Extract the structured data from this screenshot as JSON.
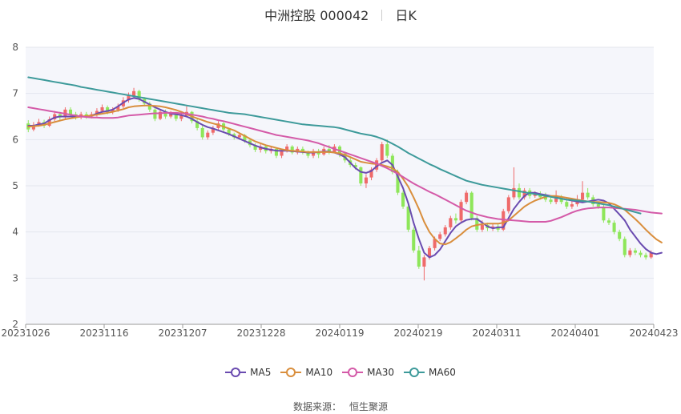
{
  "header": {
    "stock_title": "中洲控股 000042",
    "period_label": "日K"
  },
  "source": {
    "label": "数据来源：",
    "value": "恒生聚源"
  },
  "colors": {
    "up": "#ef6a6a",
    "down": "#8ee65a",
    "MA5": "#6a4bb0",
    "MA10": "#d98e3c",
    "MA30": "#d45aa8",
    "MA60": "#3d9a9a",
    "plot_bg": "#f5f6fb",
    "grid": "#e4e6ee"
  },
  "chart_data": {
    "type": "candlestick",
    "title": "中洲控股 000042",
    "subtitle": "日K",
    "ylim": [
      2,
      8
    ],
    "yticks": [
      2,
      3,
      4,
      5,
      6,
      7,
      8
    ],
    "grid": true,
    "legend_position": "bottom",
    "xticks": [
      "20231026",
      "20231116",
      "20231207",
      "20231228",
      "20240119",
      "20240219",
      "20240311",
      "20240401",
      "20240423"
    ],
    "candles": [
      {
        "o": 6.35,
        "c": 6.22,
        "h": 6.42,
        "l": 6.16
      },
      {
        "o": 6.22,
        "c": 6.32,
        "h": 6.38,
        "l": 6.18
      },
      {
        "o": 6.32,
        "c": 6.38,
        "h": 6.45,
        "l": 6.28
      },
      {
        "o": 6.38,
        "c": 6.3,
        "h": 6.43,
        "l": 6.25
      },
      {
        "o": 6.3,
        "c": 6.44,
        "h": 6.5,
        "l": 6.27
      },
      {
        "o": 6.44,
        "c": 6.55,
        "h": 6.62,
        "l": 6.4
      },
      {
        "o": 6.55,
        "c": 6.48,
        "h": 6.6,
        "l": 6.42
      },
      {
        "o": 6.48,
        "c": 6.65,
        "h": 6.7,
        "l": 6.45
      },
      {
        "o": 6.65,
        "c": 6.55,
        "h": 6.7,
        "l": 6.5
      },
      {
        "o": 6.55,
        "c": 6.48,
        "h": 6.6,
        "l": 6.43
      },
      {
        "o": 6.48,
        "c": 6.55,
        "h": 6.6,
        "l": 6.44
      },
      {
        "o": 6.55,
        "c": 6.5,
        "h": 6.6,
        "l": 6.45
      },
      {
        "o": 6.5,
        "c": 6.55,
        "h": 6.6,
        "l": 6.46
      },
      {
        "o": 6.55,
        "c": 6.62,
        "h": 6.68,
        "l": 6.5
      },
      {
        "o": 6.62,
        "c": 6.7,
        "h": 6.76,
        "l": 6.58
      },
      {
        "o": 6.7,
        "c": 6.6,
        "h": 6.74,
        "l": 6.55
      },
      {
        "o": 6.6,
        "c": 6.65,
        "h": 6.7,
        "l": 6.55
      },
      {
        "o": 6.65,
        "c": 6.72,
        "h": 6.78,
        "l": 6.6
      },
      {
        "o": 6.72,
        "c": 6.85,
        "h": 6.92,
        "l": 6.68
      },
      {
        "o": 6.85,
        "c": 6.95,
        "h": 7.02,
        "l": 6.8
      },
      {
        "o": 6.95,
        "c": 7.05,
        "h": 7.12,
        "l": 6.9
      },
      {
        "o": 7.05,
        "c": 6.88,
        "h": 7.08,
        "l": 6.82
      },
      {
        "o": 6.88,
        "c": 6.78,
        "h": 6.92,
        "l": 6.72
      },
      {
        "o": 6.78,
        "c": 6.65,
        "h": 6.82,
        "l": 6.6
      },
      {
        "o": 6.65,
        "c": 6.45,
        "h": 6.68,
        "l": 6.4
      },
      {
        "o": 6.45,
        "c": 6.6,
        "h": 6.65,
        "l": 6.42
      },
      {
        "o": 6.6,
        "c": 6.5,
        "h": 6.65,
        "l": 6.45
      },
      {
        "o": 6.5,
        "c": 6.55,
        "h": 6.62,
        "l": 6.46
      },
      {
        "o": 6.55,
        "c": 6.45,
        "h": 6.58,
        "l": 6.4
      },
      {
        "o": 6.45,
        "c": 6.52,
        "h": 6.58,
        "l": 6.4
      },
      {
        "o": 6.52,
        "c": 6.6,
        "h": 6.72,
        "l": 6.48
      },
      {
        "o": 6.6,
        "c": 6.4,
        "h": 6.62,
        "l": 6.35
      },
      {
        "o": 6.4,
        "c": 6.25,
        "h": 6.45,
        "l": 6.2
      },
      {
        "o": 6.25,
        "c": 6.05,
        "h": 6.3,
        "l": 6.0
      },
      {
        "o": 6.05,
        "c": 6.15,
        "h": 6.2,
        "l": 6.0
      },
      {
        "o": 6.15,
        "c": 6.25,
        "h": 6.3,
        "l": 6.1
      },
      {
        "o": 6.25,
        "c": 6.35,
        "h": 6.4,
        "l": 6.2
      },
      {
        "o": 6.35,
        "c": 6.22,
        "h": 6.38,
        "l": 6.18
      },
      {
        "o": 6.22,
        "c": 6.12,
        "h": 6.25,
        "l": 6.08
      },
      {
        "o": 6.12,
        "c": 6.05,
        "h": 6.15,
        "l": 6.0
      },
      {
        "o": 6.05,
        "c": 6.1,
        "h": 6.15,
        "l": 6.0
      },
      {
        "o": 6.1,
        "c": 5.98,
        "h": 6.12,
        "l": 5.93
      },
      {
        "o": 5.98,
        "c": 5.88,
        "h": 6.02,
        "l": 5.83
      },
      {
        "o": 5.88,
        "c": 5.78,
        "h": 5.92,
        "l": 5.73
      },
      {
        "o": 5.78,
        "c": 5.85,
        "h": 5.9,
        "l": 5.72
      },
      {
        "o": 5.85,
        "c": 5.75,
        "h": 5.88,
        "l": 5.7
      },
      {
        "o": 5.75,
        "c": 5.8,
        "h": 5.85,
        "l": 5.7
      },
      {
        "o": 5.8,
        "c": 5.65,
        "h": 5.82,
        "l": 5.6
      },
      {
        "o": 5.65,
        "c": 5.75,
        "h": 5.8,
        "l": 5.6
      },
      {
        "o": 5.75,
        "c": 5.85,
        "h": 5.9,
        "l": 5.72
      },
      {
        "o": 5.85,
        "c": 5.72,
        "h": 5.88,
        "l": 5.68
      },
      {
        "o": 5.72,
        "c": 5.8,
        "h": 5.85,
        "l": 5.68
      },
      {
        "o": 5.8,
        "c": 5.72,
        "h": 5.85,
        "l": 5.68
      },
      {
        "o": 5.72,
        "c": 5.65,
        "h": 5.76,
        "l": 5.6
      },
      {
        "o": 5.65,
        "c": 5.75,
        "h": 5.8,
        "l": 5.6
      },
      {
        "o": 5.75,
        "c": 5.68,
        "h": 5.8,
        "l": 5.6
      },
      {
        "o": 5.68,
        "c": 5.8,
        "h": 5.85,
        "l": 5.65
      },
      {
        "o": 5.8,
        "c": 5.72,
        "h": 5.88,
        "l": 5.68
      },
      {
        "o": 5.72,
        "c": 5.85,
        "h": 5.9,
        "l": 5.7
      },
      {
        "o": 5.85,
        "c": 5.7,
        "h": 5.88,
        "l": 5.62
      },
      {
        "o": 5.7,
        "c": 5.55,
        "h": 5.72,
        "l": 5.5
      },
      {
        "o": 5.55,
        "c": 5.45,
        "h": 5.6,
        "l": 5.4
      },
      {
        "o": 5.45,
        "c": 5.4,
        "h": 5.5,
        "l": 5.35
      },
      {
        "o": 5.4,
        "c": 5.05,
        "h": 5.42,
        "l": 5.0
      },
      {
        "o": 5.05,
        "c": 5.18,
        "h": 5.25,
        "l": 4.95
      },
      {
        "o": 5.18,
        "c": 5.35,
        "h": 5.4,
        "l": 5.12
      },
      {
        "o": 5.35,
        "c": 5.55,
        "h": 5.6,
        "l": 5.3
      },
      {
        "o": 5.55,
        "c": 5.9,
        "h": 5.95,
        "l": 5.5
      },
      {
        "o": 5.9,
        "c": 5.65,
        "h": 6.0,
        "l": 5.6
      },
      {
        "o": 5.65,
        "c": 5.3,
        "h": 5.7,
        "l": 5.25
      },
      {
        "o": 5.3,
        "c": 4.85,
        "h": 5.35,
        "l": 4.8
      },
      {
        "o": 4.85,
        "c": 4.55,
        "h": 4.9,
        "l": 4.5
      },
      {
        "o": 4.55,
        "c": 4.05,
        "h": 4.6,
        "l": 4.0
      },
      {
        "o": 4.05,
        "c": 3.6,
        "h": 4.1,
        "l": 3.55
      },
      {
        "o": 3.6,
        "c": 3.25,
        "h": 3.7,
        "l": 3.2
      },
      {
        "o": 3.25,
        "c": 3.45,
        "h": 3.5,
        "l": 2.95
      },
      {
        "o": 3.45,
        "c": 3.65,
        "h": 3.7,
        "l": 3.4
      },
      {
        "o": 3.65,
        "c": 3.85,
        "h": 3.9,
        "l": 3.6
      },
      {
        "o": 3.85,
        "c": 3.95,
        "h": 4.0,
        "l": 3.8
      },
      {
        "o": 3.95,
        "c": 4.1,
        "h": 4.15,
        "l": 3.9
      },
      {
        "o": 4.1,
        "c": 4.3,
        "h": 4.35,
        "l": 4.05
      },
      {
        "o": 4.3,
        "c": 4.25,
        "h": 4.4,
        "l": 4.18
      },
      {
        "o": 4.25,
        "c": 4.65,
        "h": 4.7,
        "l": 4.2
      },
      {
        "o": 4.65,
        "c": 4.85,
        "h": 4.9,
        "l": 4.6
      },
      {
        "o": 4.85,
        "c": 4.3,
        "h": 4.88,
        "l": 4.25
      },
      {
        "o": 4.3,
        "c": 4.05,
        "h": 4.35,
        "l": 4.0
      },
      {
        "o": 4.05,
        "c": 4.15,
        "h": 4.25,
        "l": 4.0
      },
      {
        "o": 4.15,
        "c": 4.08,
        "h": 4.2,
        "l": 4.02
      },
      {
        "o": 4.08,
        "c": 4.12,
        "h": 4.18,
        "l": 4.02
      },
      {
        "o": 4.12,
        "c": 4.05,
        "h": 4.18,
        "l": 4.0
      },
      {
        "o": 4.05,
        "c": 4.45,
        "h": 4.5,
        "l": 4.02
      },
      {
        "o": 4.45,
        "c": 4.75,
        "h": 4.8,
        "l": 4.4
      },
      {
        "o": 4.75,
        "c": 4.95,
        "h": 5.4,
        "l": 4.7
      },
      {
        "o": 4.95,
        "c": 4.75,
        "h": 5.05,
        "l": 4.7
      },
      {
        "o": 4.75,
        "c": 4.9,
        "h": 4.95,
        "l": 4.7
      },
      {
        "o": 4.9,
        "c": 4.78,
        "h": 4.95,
        "l": 4.72
      },
      {
        "o": 4.78,
        "c": 4.82,
        "h": 4.88,
        "l": 4.74
      },
      {
        "o": 4.82,
        "c": 4.75,
        "h": 4.88,
        "l": 4.7
      },
      {
        "o": 4.75,
        "c": 4.7,
        "h": 4.85,
        "l": 4.65
      },
      {
        "o": 4.7,
        "c": 4.65,
        "h": 4.75,
        "l": 4.6
      },
      {
        "o": 4.65,
        "c": 4.75,
        "h": 4.9,
        "l": 4.6
      },
      {
        "o": 4.75,
        "c": 4.65,
        "h": 4.8,
        "l": 4.6
      },
      {
        "o": 4.65,
        "c": 4.55,
        "h": 4.7,
        "l": 4.5
      },
      {
        "o": 4.55,
        "c": 4.6,
        "h": 4.68,
        "l": 4.5
      },
      {
        "o": 4.6,
        "c": 4.7,
        "h": 4.8,
        "l": 4.55
      },
      {
        "o": 4.7,
        "c": 4.85,
        "h": 5.1,
        "l": 4.65
      },
      {
        "o": 4.85,
        "c": 4.75,
        "h": 4.95,
        "l": 4.7
      },
      {
        "o": 4.75,
        "c": 4.6,
        "h": 4.8,
        "l": 4.55
      },
      {
        "o": 4.6,
        "c": 4.55,
        "h": 4.65,
        "l": 4.5
      },
      {
        "o": 4.55,
        "c": 4.25,
        "h": 4.6,
        "l": 4.2
      },
      {
        "o": 4.25,
        "c": 4.2,
        "h": 4.3,
        "l": 4.15
      },
      {
        "o": 4.2,
        "c": 4.0,
        "h": 4.25,
        "l": 3.95
      },
      {
        "o": 4.0,
        "c": 3.85,
        "h": 4.05,
        "l": 3.8
      },
      {
        "o": 3.85,
        "c": 3.5,
        "h": 3.9,
        "l": 3.45
      },
      {
        "o": 3.5,
        "c": 3.6,
        "h": 3.65,
        "l": 3.45
      },
      {
        "o": 3.6,
        "c": 3.55,
        "h": 3.65,
        "l": 3.5
      },
      {
        "o": 3.55,
        "c": 3.5,
        "h": 3.6,
        "l": 3.45
      },
      {
        "o": 3.5,
        "c": 3.45,
        "h": 3.55,
        "l": 3.4
      },
      {
        "o": 3.45,
        "c": 3.55,
        "h": 3.6,
        "l": 3.42
      }
    ],
    "series": [
      {
        "name": "MA5",
        "values": [
          6.3,
          6.3,
          6.33,
          6.35,
          6.42,
          6.48,
          6.5,
          6.5,
          6.5,
          6.5,
          6.5,
          6.5,
          6.52,
          6.56,
          6.6,
          6.62,
          6.65,
          6.72,
          6.8,
          6.87,
          6.9,
          6.88,
          6.82,
          6.76,
          6.7,
          6.65,
          6.6,
          6.56,
          6.55,
          6.53,
          6.5,
          6.45,
          6.38,
          6.32,
          6.27,
          6.24,
          6.2,
          6.16,
          6.12,
          6.07,
          6.02,
          5.97,
          5.92,
          5.87,
          5.83,
          5.8,
          5.78,
          5.76,
          5.76,
          5.76,
          5.75,
          5.74,
          5.73,
          5.72,
          5.72,
          5.73,
          5.74,
          5.74,
          5.72,
          5.68,
          5.62,
          5.5,
          5.38,
          5.3,
          5.28,
          5.32,
          5.42,
          5.5,
          5.55,
          5.45,
          5.2,
          4.95,
          4.62,
          4.2,
          3.85,
          3.55,
          3.45,
          3.5,
          3.62,
          3.8,
          3.98,
          4.12,
          4.2,
          4.26,
          4.28,
          4.28,
          4.2,
          4.12,
          4.08,
          4.1,
          4.1,
          4.3,
          4.5,
          4.65,
          4.78,
          4.85,
          4.85,
          4.82,
          4.8,
          4.78,
          4.75,
          4.72,
          4.7,
          4.68,
          4.66,
          4.64,
          4.66,
          4.68,
          4.7,
          4.68,
          4.62,
          4.5,
          4.38,
          4.25,
          4.05,
          3.9,
          3.75,
          3.63,
          3.55,
          3.52,
          3.55
        ]
      },
      {
        "name": "MA10",
        "values": [
          6.28,
          6.29,
          6.3,
          6.32,
          6.35,
          6.38,
          6.41,
          6.44,
          6.46,
          6.48,
          6.5,
          6.51,
          6.52,
          6.54,
          6.56,
          6.58,
          6.6,
          6.63,
          6.66,
          6.7,
          6.72,
          6.73,
          6.74,
          6.74,
          6.73,
          6.72,
          6.7,
          6.67,
          6.64,
          6.6,
          6.55,
          6.5,
          6.46,
          6.42,
          6.38,
          6.35,
          6.32,
          6.28,
          6.24,
          6.2,
          6.14,
          6.08,
          6.02,
          5.96,
          5.92,
          5.88,
          5.85,
          5.82,
          5.79,
          5.77,
          5.76,
          5.75,
          5.74,
          5.73,
          5.73,
          5.73,
          5.73,
          5.73,
          5.72,
          5.7,
          5.67,
          5.62,
          5.57,
          5.52,
          5.5,
          5.48,
          5.47,
          5.45,
          5.42,
          5.38,
          5.3,
          5.15,
          4.98,
          4.75,
          4.5,
          4.22,
          4.0,
          3.85,
          3.75,
          3.73,
          3.78,
          3.86,
          3.95,
          4.05,
          4.12,
          4.15,
          4.17,
          4.18,
          4.18,
          4.18,
          4.2,
          4.25,
          4.35,
          4.45,
          4.55,
          4.62,
          4.68,
          4.72,
          4.76,
          4.78,
          4.78,
          4.76,
          4.74,
          4.72,
          4.7,
          4.68,
          4.66,
          4.65,
          4.65,
          4.64,
          4.63,
          4.6,
          4.55,
          4.48,
          4.38,
          4.28,
          4.17,
          4.05,
          3.94,
          3.84,
          3.77
        ]
      },
      {
        "name": "MA30",
        "values": [
          6.7,
          6.68,
          6.66,
          6.64,
          6.62,
          6.6,
          6.58,
          6.56,
          6.54,
          6.52,
          6.5,
          6.49,
          6.48,
          6.48,
          6.47,
          6.47,
          6.47,
          6.48,
          6.5,
          6.52,
          6.53,
          6.54,
          6.55,
          6.56,
          6.57,
          6.57,
          6.58,
          6.58,
          6.58,
          6.57,
          6.56,
          6.54,
          6.52,
          6.5,
          6.47,
          6.45,
          6.42,
          6.4,
          6.37,
          6.34,
          6.31,
          6.28,
          6.25,
          6.22,
          6.19,
          6.16,
          6.13,
          6.1,
          6.08,
          6.06,
          6.04,
          6.02,
          6.0,
          5.98,
          5.95,
          5.92,
          5.88,
          5.84,
          5.8,
          5.76,
          5.72,
          5.68,
          5.64,
          5.6,
          5.56,
          5.52,
          5.48,
          5.43,
          5.38,
          5.32,
          5.26,
          5.19,
          5.12,
          5.05,
          4.99,
          4.93,
          4.87,
          4.82,
          4.76,
          4.7,
          4.64,
          4.58,
          4.52,
          4.46,
          4.42,
          4.38,
          4.35,
          4.32,
          4.3,
          4.28,
          4.27,
          4.26,
          4.25,
          4.24,
          4.23,
          4.22,
          4.22,
          4.22,
          4.22,
          4.24,
          4.28,
          4.32,
          4.37,
          4.42,
          4.46,
          4.49,
          4.51,
          4.52,
          4.53,
          4.53,
          4.53,
          4.52,
          4.51,
          4.5,
          4.49,
          4.48,
          4.46,
          4.44,
          4.42,
          4.41,
          4.4
        ]
      },
      {
        "name": "MA60",
        "values": [
          7.35,
          7.33,
          7.31,
          7.29,
          7.27,
          7.25,
          7.23,
          7.21,
          7.19,
          7.17,
          7.14,
          7.12,
          7.1,
          7.08,
          7.06,
          7.04,
          7.02,
          7.0,
          6.98,
          6.96,
          6.94,
          6.92,
          6.9,
          6.88,
          6.86,
          6.84,
          6.82,
          6.8,
          6.78,
          6.76,
          6.74,
          6.72,
          6.7,
          6.68,
          6.66,
          6.64,
          6.62,
          6.6,
          6.58,
          6.57,
          6.56,
          6.55,
          6.53,
          6.51,
          6.49,
          6.47,
          6.45,
          6.43,
          6.41,
          6.39,
          6.37,
          6.35,
          6.33,
          6.32,
          6.31,
          6.3,
          6.29,
          6.28,
          6.27,
          6.25,
          6.22,
          6.19,
          6.16,
          6.13,
          6.11,
          6.09,
          6.06,
          6.02,
          5.97,
          5.91,
          5.85,
          5.78,
          5.71,
          5.65,
          5.59,
          5.53,
          5.47,
          5.42,
          5.36,
          5.31,
          5.26,
          5.21,
          5.16,
          5.11,
          5.08,
          5.05,
          5.02,
          5.0,
          4.98,
          4.96,
          4.94,
          4.92,
          4.9,
          4.88,
          4.86,
          4.84,
          4.82,
          4.8,
          4.78,
          4.76,
          4.74,
          4.72,
          4.7,
          4.69,
          4.68,
          4.67,
          4.66,
          4.64,
          4.62,
          4.6,
          4.58,
          4.55,
          4.52,
          4.49,
          4.46,
          4.43,
          4.4
        ]
      }
    ]
  }
}
